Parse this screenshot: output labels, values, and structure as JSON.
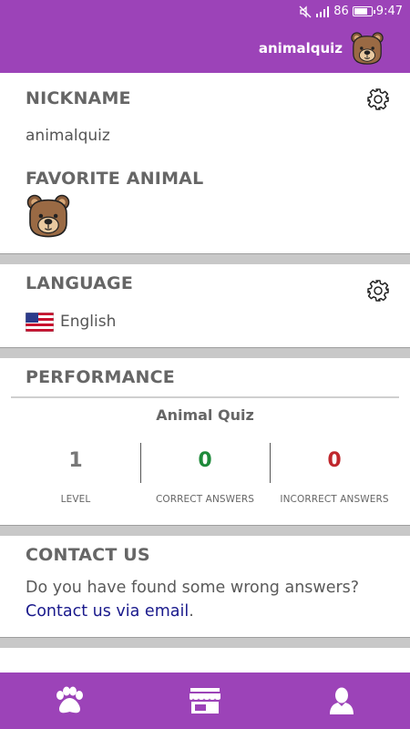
{
  "status_bar": {
    "battery_level": "86",
    "time": "9:47"
  },
  "header": {
    "username": "animalquiz",
    "avatar_icon": "bear-face-icon"
  },
  "profile": {
    "nickname_title": "NICKNAME",
    "nickname_value": "animalquiz",
    "favorite_animal_title": "FAVORITE ANIMAL",
    "favorite_animal_icon": "bear-face-icon"
  },
  "language": {
    "title": "LANGUAGE",
    "value": "English",
    "flag_icon": "us-flag-icon"
  },
  "performance": {
    "title": "PERFORMANCE",
    "quiz_name": "Animal Quiz",
    "stats": [
      {
        "value": "1",
        "label": "LEVEL",
        "color": "#777777"
      },
      {
        "value": "0",
        "label": "CORRECT ANSWERS",
        "color": "#1e8a3a"
      },
      {
        "value": "0",
        "label": "INCORRECT ANSWERS",
        "color": "#c0272d"
      }
    ]
  },
  "contact": {
    "title": "CONTACT US",
    "question": "Do you have found some wrong answers?",
    "link_text": "Contact us via email",
    "link_suffix": "."
  },
  "bottom_nav": {
    "items": [
      {
        "icon": "paw-icon"
      },
      {
        "icon": "store-icon"
      },
      {
        "icon": "user-icon"
      }
    ]
  },
  "colors": {
    "primary": "#9c43b8",
    "link": "#1a1a8c",
    "correct": "#1e8a3a",
    "incorrect": "#c0272d"
  }
}
